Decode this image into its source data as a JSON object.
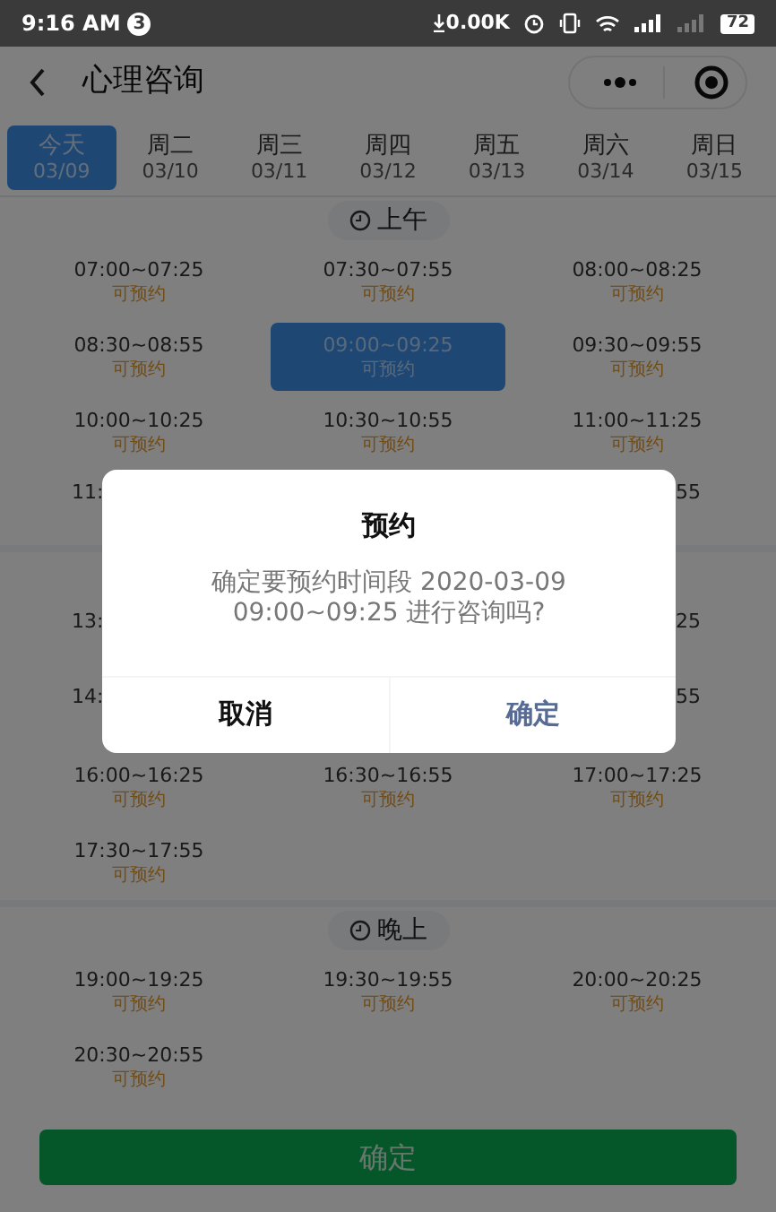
{
  "status_bar": {
    "time": "9:16 AM",
    "notification_count": "3",
    "net_speed": "0.00K",
    "battery": "72"
  },
  "nav": {
    "title": "心理咨询"
  },
  "days": [
    {
      "day": "今天",
      "date": "03/09",
      "selected": true
    },
    {
      "day": "周二",
      "date": "03/10",
      "selected": false
    },
    {
      "day": "周三",
      "date": "03/11",
      "selected": false
    },
    {
      "day": "周四",
      "date": "03/12",
      "selected": false
    },
    {
      "day": "周五",
      "date": "03/13",
      "selected": false
    },
    {
      "day": "周六",
      "date": "03/14",
      "selected": false
    },
    {
      "day": "周日",
      "date": "03/15",
      "selected": false
    }
  ],
  "sections": [
    {
      "label": "上午",
      "rows": [
        [
          {
            "kind": "full",
            "time": "07:00~07:25",
            "status": "可预约",
            "selected": false
          },
          {
            "kind": "full",
            "time": "07:30~07:55",
            "status": "可预约",
            "selected": false
          },
          {
            "kind": "full",
            "time": "08:00~08:25",
            "status": "可预约",
            "selected": false
          }
        ],
        [
          {
            "kind": "full",
            "time": "08:30~08:55",
            "status": "可预约",
            "selected": false
          },
          {
            "kind": "full",
            "time": "09:00~09:25",
            "status": "可预约",
            "selected": true
          },
          {
            "kind": "full",
            "time": "09:30~09:55",
            "status": "可预约",
            "selected": false
          }
        ],
        [
          {
            "kind": "full",
            "time": "10:00~10:25",
            "status": "可预约",
            "selected": false
          },
          {
            "kind": "full",
            "time": "10:30~10:55",
            "status": "可预约",
            "selected": false
          },
          {
            "kind": "full",
            "time": "11:00~11:25",
            "status": "可预约",
            "selected": false
          }
        ],
        [
          {
            "kind": "cut_left",
            "time": "11:"
          },
          {
            "kind": "covered"
          },
          {
            "kind": "cut_right",
            "time": "55"
          }
        ]
      ]
    },
    {
      "rows": [
        [
          {
            "kind": "cut_left",
            "time": "13:"
          },
          {
            "kind": "covered"
          },
          {
            "kind": "cut_right",
            "time": "25"
          }
        ],
        [
          {
            "kind": "cut_left",
            "time": "14:"
          },
          {
            "kind": "covered"
          },
          {
            "kind": "cut_right",
            "time": "55"
          }
        ],
        [
          {
            "kind": "full",
            "time": "16:00~16:25",
            "status": "可预约",
            "selected": false
          },
          {
            "kind": "full",
            "time": "16:30~16:55",
            "status": "可预约",
            "selected": false
          },
          {
            "kind": "full",
            "time": "17:00~17:25",
            "status": "可预约",
            "selected": false
          }
        ],
        [
          {
            "kind": "full",
            "time": "17:30~17:55",
            "status": "可预约",
            "selected": false
          }
        ]
      ]
    },
    {
      "label": "晚上",
      "rows": [
        [
          {
            "kind": "full",
            "time": "19:00~19:25",
            "status": "可预约",
            "selected": false
          },
          {
            "kind": "full",
            "time": "19:30~19:55",
            "status": "可预约",
            "selected": false
          },
          {
            "kind": "full",
            "time": "20:00~20:25",
            "status": "可预约",
            "selected": false
          }
        ],
        [
          {
            "kind": "full",
            "time": "20:30~20:55",
            "status": "可预约",
            "selected": false
          }
        ]
      ]
    }
  ],
  "submit_button": "确定",
  "dialog": {
    "title": "预约",
    "message": "确定要预约时间段 2020-03-09 09:00~09:25 进行咨询吗?",
    "buttons": [
      {
        "label": "取消",
        "kind": "cancel"
      },
      {
        "label": "确定",
        "kind": "confirm"
      }
    ]
  }
}
